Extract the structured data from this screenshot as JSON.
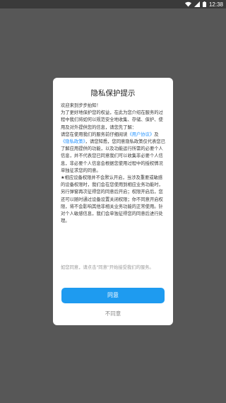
{
  "status_bar": {
    "time": "12:38",
    "icons": [
      "wifi-icon",
      "signal-icon",
      "battery-icon"
    ]
  },
  "dialog": {
    "title": "隐私保护提示",
    "body": {
      "l1": "欢迎来到步步拍知！",
      "l2": "为了更好地保护您的权益，在此为您介绍在服务的过程中我们将如何以规范安全地收集、存储、保护、使用及对外提供您的信息，请您先了解：",
      "l3_a": "请您在使用我们的服务前仔细阅读",
      "user_agreement": "《用户协议》",
      "l3_b": "及",
      "privacy_policy": "《隐私政策》",
      "l3_c": "，请您知悉，您同意隐私政策仅代表您已了解应用提供的功能，以及功能运行所需的必要个人信息，并不代表您已同意我们可以收集非必要个人信息，非必要个人信息会根据您使用过程中的授权情况单独征求您的同意。",
      "l4": "★相应设备权限并不会默认开启，当涉及重要或敏感的设备权限时，我们会在您使用到相应业务功能时，另行弹窗再次征得您的同意后开启；权限开启后，您还可以随时通过设备设置关闭权限；你不同意开启权限，将不会影响其他非相关业务功能的正常使用。针对个人敏感信息，我们会单独征得您的同意后进行处理。"
    },
    "note": "如您同意，请点击\"同意\"开始接受我们的服务。",
    "agree_label": "同意",
    "disagree_label": "不同意"
  },
  "colors": {
    "overlay": "#575757",
    "accent": "#1e9bf0",
    "link": "#1e90ff"
  }
}
